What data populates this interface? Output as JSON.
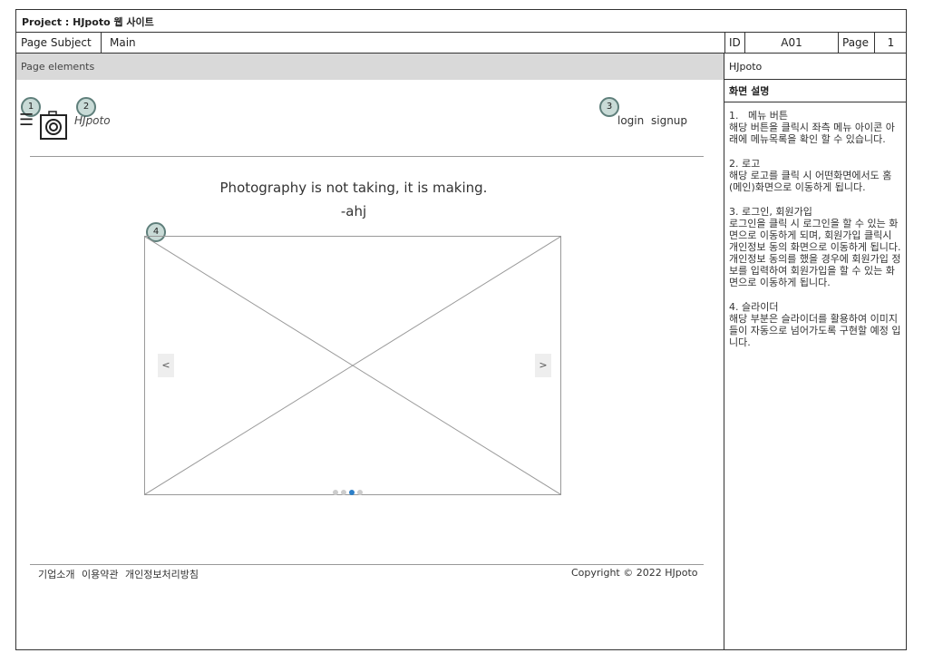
{
  "header": {
    "project": "Project : HJpoto 웹 사이트"
  },
  "meta": {
    "subject_label": "Page Subject",
    "subject_value": "Main",
    "id_label": "ID",
    "id_value": "A01",
    "page_label": "Page",
    "page_value": "1"
  },
  "left": {
    "elements_label": "Page elements"
  },
  "right": {
    "site_name": "HJpoto",
    "desc_title": "화면 설명",
    "sections": [
      {
        "title": "1.   메뉴 버튼",
        "body": "해당 버튼을 클릭시 좌측 메뉴 아이콘 아래에 메뉴목록을 확인 할 수 있습니다."
      },
      {
        "title": "2. 로고",
        "body": "해당 로고를 클릭 시 어떤화면에서도 홈(메인)화면으로 이동하게 됩니다."
      },
      {
        "title": "3. 로그인, 회원가입",
        "body": "로그인을 클릭 시 로그인을 할 수 있는 화면으로 이동하게 되며, 회원가입 클릭시 개인정보 동의 화면으로 이동하게 됩니다. 개인정보 동의를 했을 경우에 회원가입 정보를 입력하여 회원가입을 할 수 있는 화면으로 이동하게 됩니다."
      },
      {
        "title": "4. 슬라이더",
        "body": "해당 부분은 슬라이더를 활용하여 이미지들이 자동으로 넘어가도록 구현할 예정 입니다."
      }
    ]
  },
  "wireframe": {
    "badges": [
      "1",
      "2",
      "3",
      "4"
    ],
    "menu_icon": "hamburger-icon",
    "logo_icon": "camera-icon",
    "logo_text": "HJpoto",
    "login": "login",
    "signup": "signup",
    "quote_line1": "Photography is not taking, it is making.",
    "quote_line2": "-ahj",
    "slider_prev": "<",
    "slider_next": ">",
    "slider_active_index": 2,
    "slider_total": 4,
    "footer_links": [
      "기업소개",
      "이용약관",
      "개인정보처리방침"
    ],
    "copyright": "Copyright © 2022 HJpoto"
  }
}
